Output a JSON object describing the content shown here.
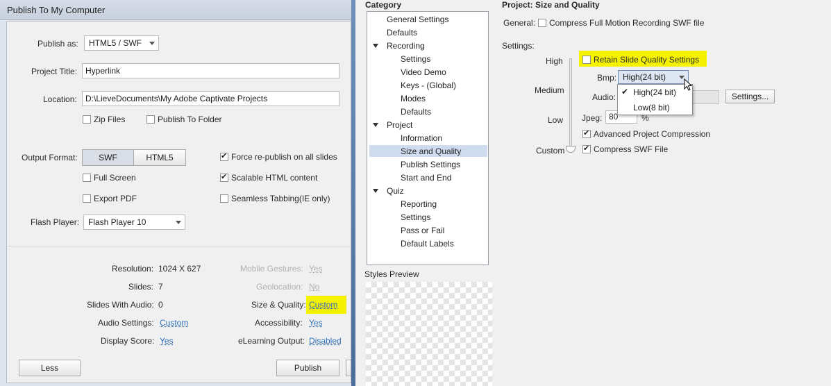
{
  "dialog": {
    "title": "Publish To My Computer",
    "publish_as_label": "Publish as:",
    "publish_as_value": "HTML5 / SWF",
    "project_title_label": "Project Title:",
    "project_title_value": "Hyperlink",
    "location_label": "Location:",
    "location_value": "D:\\LieveDocuments\\My Adobe Captivate Projects",
    "zip_files": "Zip Files",
    "publish_to_folder": "Publish To Folder",
    "output_format_label": "Output Format:",
    "output_swf": "SWF",
    "output_html5": "HTML5",
    "force_republish": "Force re-publish on all slides",
    "full_screen": "Full Screen",
    "scalable_html": "Scalable HTML content",
    "export_pdf": "Export PDF",
    "seamless_tabbing": "Seamless Tabbing(IE only)",
    "flash_player_label": "Flash Player:",
    "flash_player_value": "Flash Player 10",
    "summary": {
      "resolution_label": "Resolution:",
      "resolution_value": "1024 X 627",
      "slides_label": "Slides:",
      "slides_value": "7",
      "slides_audio_label": "Slides With Audio:",
      "slides_audio_value": "0",
      "audio_settings_label": "Audio Settings:",
      "audio_settings_value": "Custom",
      "display_score_label": "Display Score:",
      "display_score_value": "Yes",
      "mobile_gestures_label": "Mobile Gestures:",
      "mobile_gestures_value": "Yes",
      "geolocation_label": "Geolocation:",
      "geolocation_value": "No",
      "size_quality_label": "Size & Quality:",
      "size_quality_value": "Custom",
      "accessibility_label": "Accessibility:",
      "accessibility_value": "Yes",
      "elearning_label": "eLearning Output:",
      "elearning_value": "Disabled"
    },
    "less_button": "Less",
    "publish_button": "Publish"
  },
  "category": {
    "heading": "Category",
    "items": [
      {
        "label": "General Settings"
      },
      {
        "label": "Defaults"
      },
      {
        "label": "Recording"
      },
      {
        "label": "Settings"
      },
      {
        "label": "Video Demo"
      },
      {
        "label": "Keys - (Global)"
      },
      {
        "label": "Modes"
      },
      {
        "label": "Defaults"
      },
      {
        "label": "Project"
      },
      {
        "label": "Information"
      },
      {
        "label": "Size and Quality"
      },
      {
        "label": "Publish Settings"
      },
      {
        "label": "Start and End"
      },
      {
        "label": "Quiz"
      },
      {
        "label": "Reporting"
      },
      {
        "label": "Settings"
      },
      {
        "label": "Pass or Fail"
      },
      {
        "label": "Default Labels"
      }
    ],
    "styles_preview": "Styles Preview"
  },
  "project_panel": {
    "heading": "Project: Size and Quality",
    "general_label": "General:",
    "compress_full_motion": "Compress Full Motion Recording SWF file",
    "settings_label": "Settings:",
    "level_high": "High",
    "level_medium": "Medium",
    "level_low": "Low",
    "level_custom": "Custom",
    "retain_quality": "Retain Slide Quality Settings",
    "bmp_label": "Bmp:",
    "bmp_value": "High(24 bit)",
    "bmp_options": [
      "High(24 bit)",
      "Low(8 bit)"
    ],
    "audio_label": "Audio:",
    "audio_settings_button": "Settings...",
    "jpeg_label": "Jpeg:",
    "jpeg_value": "80",
    "jpeg_unit": "%",
    "advanced_compression": "Advanced Project Compression",
    "compress_swf": "Compress SWF File"
  },
  "colors": {
    "highlight": "#f5f200",
    "link": "#2d6fb8",
    "selection": "#cfdcf0"
  }
}
